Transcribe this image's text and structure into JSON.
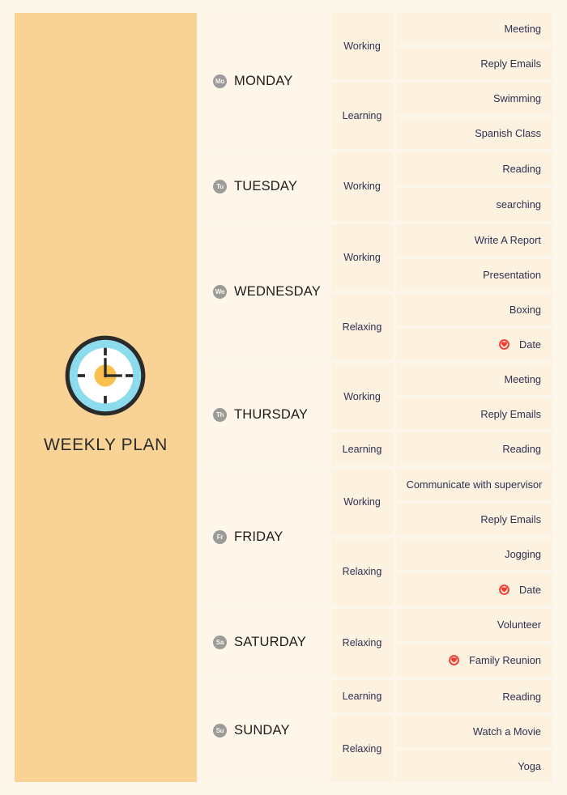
{
  "cover": {
    "title": "WEEKLY PLAN",
    "background_color": "#f8d395",
    "clock_icon": "clock-icon",
    "clock_colors": {
      "outer_ring": "#2b2b2b",
      "inner_ring": "#8ddcee",
      "face": "#ffffff",
      "center": "#f9c04d"
    }
  },
  "theme": {
    "page_background": "#fdf6ea",
    "day_cell_background": "#fdf6e9",
    "activity_cell_background": "#fdf2e0",
    "text_color": "#2e3050",
    "day_label_color": "#1d1d1d",
    "badge_color": "#9b9b9b",
    "heart_accent": "#f4392d"
  },
  "days": [
    {
      "badge": "Mo",
      "label": "MONDAY",
      "groups": [
        {
          "category": "Working",
          "activities": [
            {
              "text": "Meeting",
              "icon": "none"
            },
            {
              "text": "Reply Emails",
              "icon": "none"
            }
          ]
        },
        {
          "category": "Learning",
          "activities": [
            {
              "text": "Swimming",
              "icon": "none"
            },
            {
              "text": "Spanish Class",
              "icon": "none"
            }
          ]
        }
      ]
    },
    {
      "badge": "Tu",
      "label": "TUESDAY",
      "groups": [
        {
          "category": "Working",
          "activities": [
            {
              "text": "Reading",
              "icon": "none"
            },
            {
              "text": "searching",
              "icon": "none"
            }
          ]
        }
      ]
    },
    {
      "badge": "We",
      "label": "WEDNESDAY",
      "groups": [
        {
          "category": "Working",
          "activities": [
            {
              "text": "Write A Report",
              "icon": "none"
            },
            {
              "text": "Presentation",
              "icon": "none"
            }
          ]
        },
        {
          "category": "Relaxing",
          "activities": [
            {
              "text": "Boxing",
              "icon": "none"
            },
            {
              "text": "Date",
              "icon": "heart-icon"
            }
          ]
        }
      ]
    },
    {
      "badge": "Th",
      "label": "THURSDAY",
      "groups": [
        {
          "category": "Working",
          "activities": [
            {
              "text": "Meeting",
              "icon": "none"
            },
            {
              "text": "Reply Emails",
              "icon": "none"
            }
          ]
        },
        {
          "category": "Learning",
          "activities": [
            {
              "text": "Reading",
              "icon": "none"
            }
          ]
        }
      ]
    },
    {
      "badge": "Fr",
      "label": "FRIDAY",
      "groups": [
        {
          "category": "Working",
          "activities": [
            {
              "text": "Communicate with supervisor",
              "icon": "none",
              "centered": true
            },
            {
              "text": "Reply Emails",
              "icon": "none"
            }
          ]
        },
        {
          "category": "Relaxing",
          "activities": [
            {
              "text": "Jogging",
              "icon": "none"
            },
            {
              "text": "Date",
              "icon": "heart-icon"
            }
          ]
        }
      ]
    },
    {
      "badge": "Sa",
      "label": "SATURDAY",
      "groups": [
        {
          "category": "Relaxing",
          "activities": [
            {
              "text": "Volunteer",
              "icon": "none"
            },
            {
              "text": "Family Reunion",
              "icon": "heart-icon"
            }
          ]
        }
      ]
    },
    {
      "badge": "Su",
      "label": "SUNDAY",
      "groups": [
        {
          "category": "Learning",
          "activities": [
            {
              "text": "Reading",
              "icon": "none"
            }
          ]
        },
        {
          "category": "Relaxing",
          "activities": [
            {
              "text": "Watch a Movie",
              "icon": "none"
            },
            {
              "text": "Yoga",
              "icon": "none"
            }
          ]
        }
      ]
    }
  ]
}
